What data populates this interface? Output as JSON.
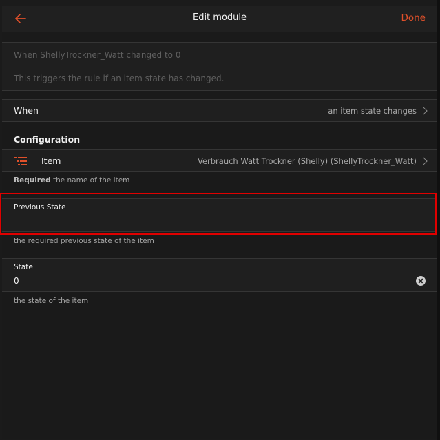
{
  "navbar": {
    "title": "Edit module",
    "done_label": "Done",
    "back_icon": "arrow-left-icon",
    "accent_color": "#e0502a"
  },
  "summary": {
    "label": "When ShellyTrockner_Watt changed to 0",
    "description": "This triggers the rule if an item state has changed."
  },
  "when_row": {
    "label": "When",
    "value": "an item state changes"
  },
  "configuration": {
    "title": "Configuration",
    "item_row": {
      "icon": "list-icon",
      "label": "Item",
      "value": "Verbrauch Watt Trockner (Shelly) (ShellyTrockner_Watt)"
    },
    "item_helper_bold": "Required",
    "item_helper_rest": " the name of the item",
    "previous_state": {
      "label": "Previous State",
      "value": "",
      "helper": "the required previous state of the item"
    },
    "state": {
      "label": "State",
      "value": "0",
      "helper": "the state of the item",
      "clear_icon": "clear-circle-icon"
    }
  }
}
